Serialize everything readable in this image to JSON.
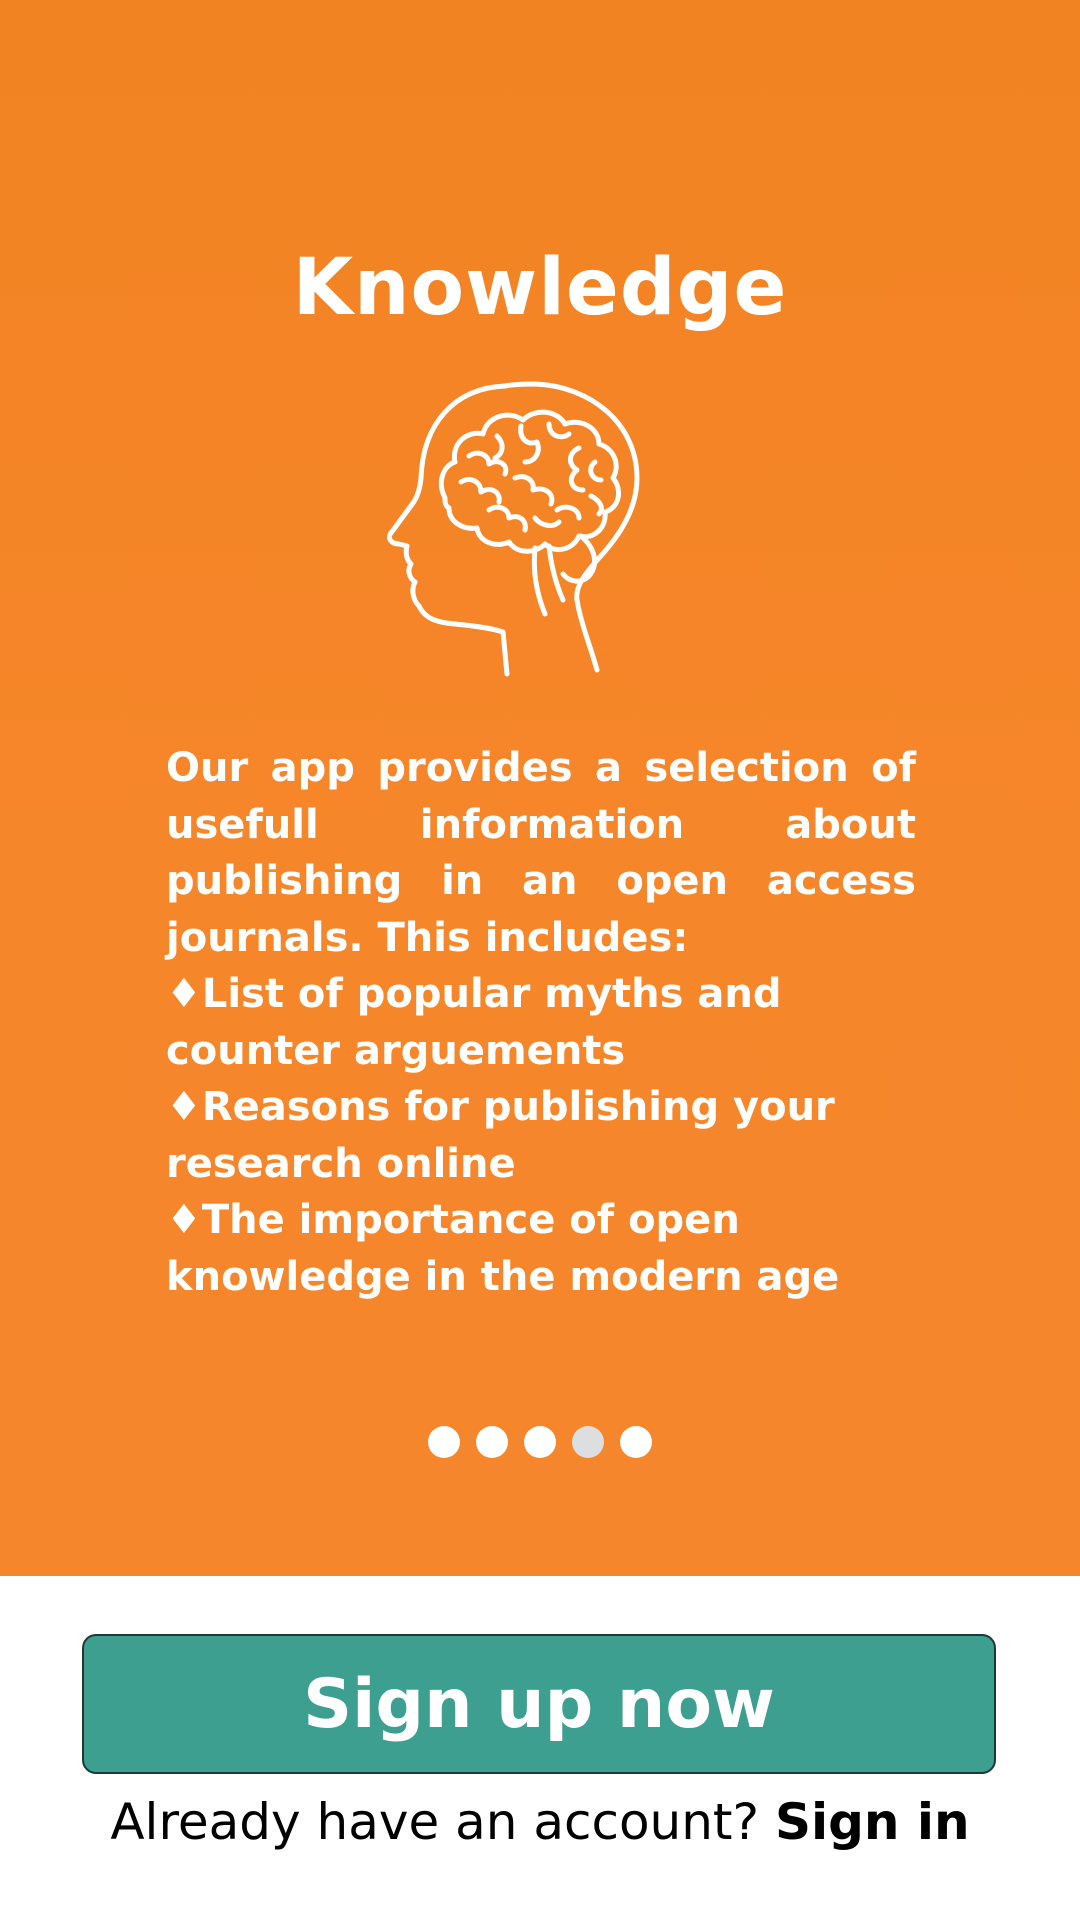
{
  "onboarding": {
    "title": "Knowledge",
    "illustration_icon": "brain-head-icon",
    "description_intro": "Our app provides a selection of usefull information about publishing in an open access journals. This includes:",
    "bullets": [
      "♦List of popular myths and counter arguements",
      "♦Reasons for publishing your research online",
      "♦The importance of open knowledge in the modern age"
    ],
    "pagination": {
      "total": 5,
      "active_index": 3
    }
  },
  "actions": {
    "signup_label": "Sign up now",
    "signin_prompt": "Already have an account?",
    "signin_label": "Sign in"
  },
  "colors": {
    "hero_background": "#f5862a",
    "signup_button": "#3d9f8f",
    "text_on_hero": "#ffffff"
  }
}
